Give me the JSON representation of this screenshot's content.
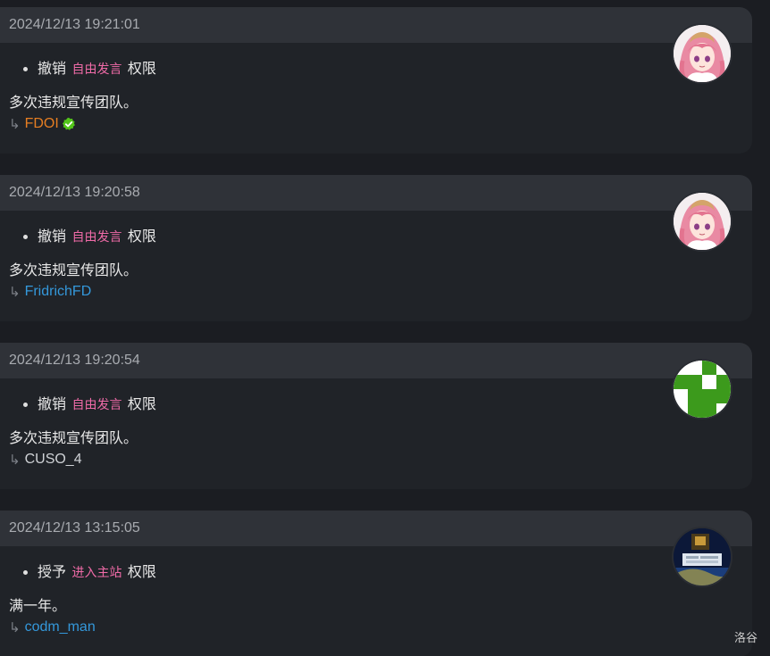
{
  "records": [
    {
      "timestamp": "2024/12/13 19:21:01",
      "action": "撤销",
      "permission": "自由发言",
      "suffix": "权限",
      "reason": "多次违规宣传团队。",
      "arrow": "↳",
      "operator": "FDOI",
      "operator_color": "#e67e22",
      "verified": true,
      "avatar": "anime-girl-avatar"
    },
    {
      "timestamp": "2024/12/13 19:20:58",
      "action": "撤销",
      "permission": "自由发言",
      "suffix": "权限",
      "reason": "多次违规宣传团队。",
      "arrow": "↳",
      "operator": "FridrichFD",
      "operator_color": "#3498db",
      "verified": false,
      "avatar": "anime-girl-avatar"
    },
    {
      "timestamp": "2024/12/13 19:20:54",
      "action": "撤销",
      "permission": "自由发言",
      "suffix": "权限",
      "reason": "多次违规宣传团队。",
      "arrow": "↳",
      "operator": "CUSO_4",
      "operator_color": "#cfd2d6",
      "verified": false,
      "avatar": "green-pixel-avatar"
    },
    {
      "timestamp": "2024/12/13 13:15:05",
      "action": "授予",
      "permission": "进入主站",
      "suffix": "权限",
      "reason": "满一年。",
      "arrow": "↳",
      "operator": "codm_man",
      "operator_color": "#3498db",
      "verified": false,
      "avatar": "night-scene-avatar"
    }
  ],
  "watermark": "洛谷",
  "colors": {
    "card_bg": "#202328",
    "header_bg": "#2f3238",
    "permission": "#f06ba8",
    "verified_badge": "#52c41a"
  }
}
